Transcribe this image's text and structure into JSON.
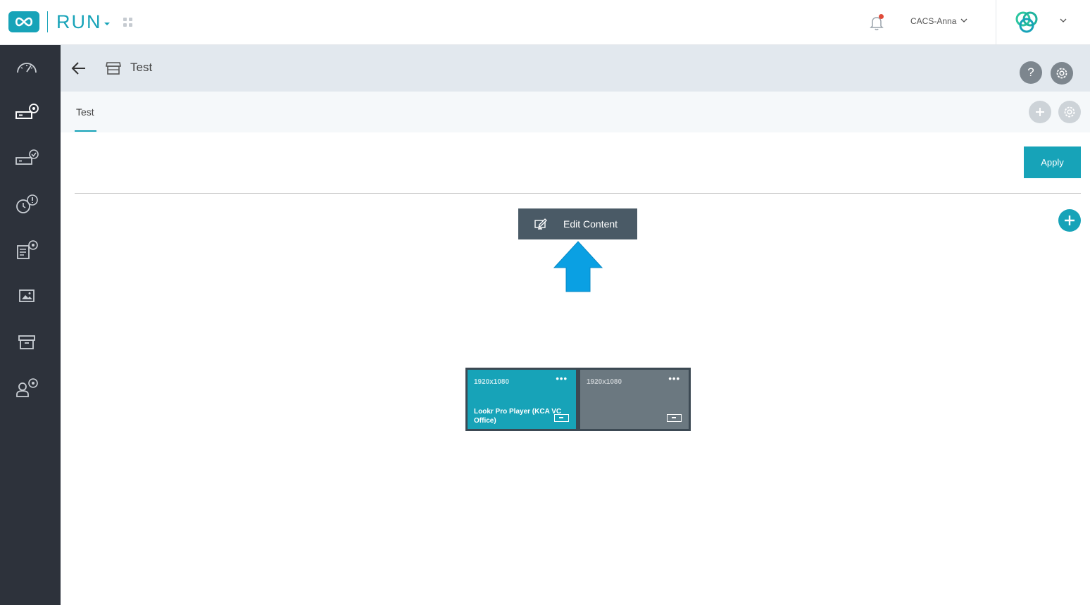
{
  "app": {
    "name": "RUN"
  },
  "header": {
    "user": "CACS-Anna"
  },
  "page": {
    "title": "Test"
  },
  "tabs": [
    {
      "label": "Test",
      "active": true
    }
  ],
  "subheader_buttons": {
    "help": "?"
  },
  "actions": {
    "apply": "Apply",
    "edit_content": "Edit Content"
  },
  "displays": [
    {
      "resolution": "1920x1080",
      "player": "Lookr Pro Player (KCA VC Office)",
      "assigned": true
    },
    {
      "resolution": "1920x1080",
      "player": "",
      "assigned": false
    }
  ],
  "sidebar": {
    "items": [
      {
        "icon": "dashboard-gauge-icon"
      },
      {
        "icon": "device-settings-icon",
        "active": true
      },
      {
        "icon": "device-check-icon"
      },
      {
        "icon": "alert-clock-icon"
      },
      {
        "icon": "content-settings-icon"
      },
      {
        "icon": "image-icon"
      },
      {
        "icon": "archive-icon"
      },
      {
        "icon": "user-settings-icon"
      }
    ]
  },
  "colors": {
    "accent": "#17a3b8",
    "sidebar": "#2d323b",
    "subheader": "#e2e8ee",
    "edit_button": "#4a5a66",
    "arrow": "#0aa0e3",
    "notification_dot": "#e04b3a"
  }
}
